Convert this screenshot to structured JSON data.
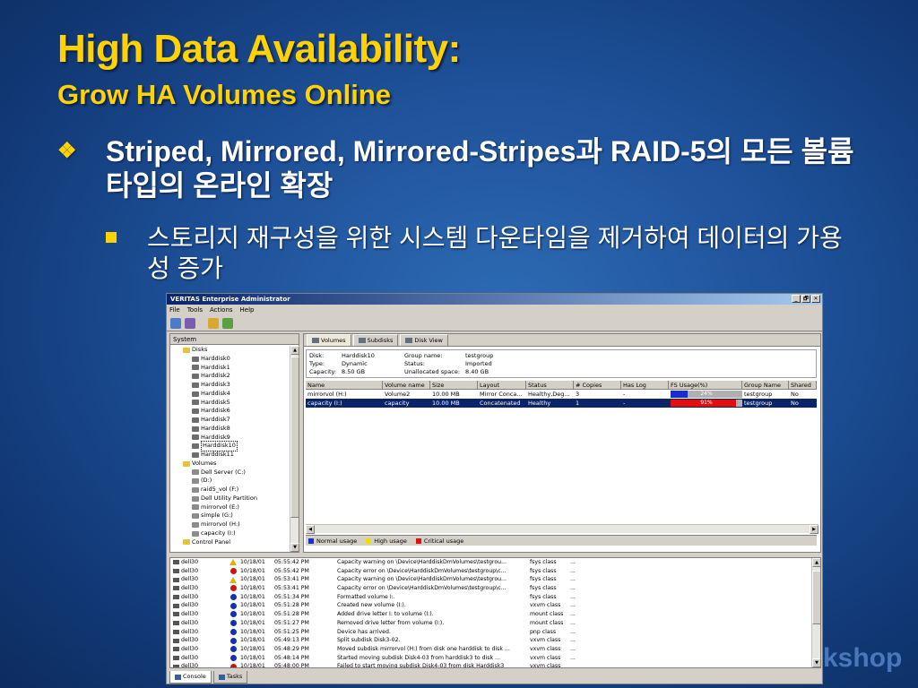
{
  "slide": {
    "title": "High Data Availability:",
    "subtitle": "Grow HA Volumes Online",
    "bullet1": "Striped, Mirrored,  Mirrored-Stripes과 RAID-5의 모든 볼륨 타입의 온라인 확장",
    "bullet2": "스토리지 재구성을 위한 시스템 다운타임을 제거하여 데이터의 가용성 증가",
    "bullet1_marker": "❖",
    "watermark": "kshop"
  },
  "window": {
    "title": "VERITAS Enterprise Administrator",
    "controls": [
      "_",
      "🗗",
      "✕"
    ],
    "menu": [
      "File",
      "Tools",
      "Actions",
      "Help"
    ],
    "toolbar_icons": [
      "connect-icon",
      "disconnect-icon",
      "new-window-icon",
      "new-volume-icon"
    ]
  },
  "tree": {
    "tab_label": "System",
    "items": [
      {
        "label": "Disks",
        "indent": 1,
        "icon": "fold"
      },
      {
        "label": "Harddisk0",
        "indent": 2,
        "icon": "disk"
      },
      {
        "label": "Harddisk1",
        "indent": 2,
        "icon": "disk"
      },
      {
        "label": "Harddisk2",
        "indent": 2,
        "icon": "disk"
      },
      {
        "label": "Harddisk3",
        "indent": 2,
        "icon": "disk"
      },
      {
        "label": "Harddisk4",
        "indent": 2,
        "icon": "disk"
      },
      {
        "label": "Harddisk5",
        "indent": 2,
        "icon": "disk"
      },
      {
        "label": "Harddisk6",
        "indent": 2,
        "icon": "disk"
      },
      {
        "label": "Harddisk7",
        "indent": 2,
        "icon": "disk"
      },
      {
        "label": "Harddisk8",
        "indent": 2,
        "icon": "disk"
      },
      {
        "label": "Harddisk9",
        "indent": 2,
        "icon": "disk"
      },
      {
        "label": "Harddisk10",
        "indent": 2,
        "icon": "disk",
        "selected": true
      },
      {
        "label": "Harddisk11",
        "indent": 2,
        "icon": "disk"
      },
      {
        "label": "Volumes",
        "indent": 1,
        "icon": "fold"
      },
      {
        "label": "Dell Server (C:)",
        "indent": 2,
        "icon": "vol"
      },
      {
        "label": "(D:)",
        "indent": 2,
        "icon": "vol"
      },
      {
        "label": "raid5_vol (F:)",
        "indent": 2,
        "icon": "vol"
      },
      {
        "label": "Dell Utility Partition",
        "indent": 2,
        "icon": "vol"
      },
      {
        "label": "mirrorvol (E:)",
        "indent": 2,
        "icon": "vol"
      },
      {
        "label": "simple (G:)",
        "indent": 2,
        "icon": "vol"
      },
      {
        "label": "mirrorvol (H:)",
        "indent": 2,
        "icon": "vol"
      },
      {
        "label": "capacity (I:)",
        "indent": 2,
        "icon": "vol"
      },
      {
        "label": "Control Panel",
        "indent": 1,
        "icon": "fold"
      }
    ]
  },
  "details": {
    "tabs": [
      "Volumes",
      "Subdisks",
      "Disk View"
    ],
    "info": [
      {
        "k1": "Disk:",
        "v1": "Harddisk10",
        "k2": "Group name:",
        "v2": "testgroup"
      },
      {
        "k1": "Type:",
        "v1": "Dynamic",
        "k2": "Status:",
        "v2": "Imported"
      },
      {
        "k1": "Capacity:",
        "v1": "8.50 GB",
        "k2": "Unallocated space:",
        "v2": "8.40 GB"
      }
    ],
    "columns": [
      "Name",
      "Volume name",
      "Size",
      "Layout",
      "Status",
      "# Copies",
      "Has Log",
      "FS Usage(%)",
      "Group Name",
      "Shared"
    ],
    "rows": [
      {
        "name": "mirrorvol (H:)",
        "volume_name": "Volume2",
        "size": "10.00 MB",
        "layout": "Mirror Conca...",
        "status": "Healthy,Deg...",
        "copies": "3",
        "has_log": "-",
        "fs_usage": 24,
        "fs_usage_label": "24%",
        "group": "testgroup",
        "shared": "No",
        "selected": false
      },
      {
        "name": "capacity (I:)",
        "volume_name": "capacity",
        "size": "10.00 MB",
        "layout": "Concatenated",
        "status": "Healthy",
        "copies": "1",
        "has_log": "-",
        "fs_usage": 91,
        "fs_usage_label": "91%",
        "group": "testgroup",
        "shared": "No",
        "selected": true
      }
    ],
    "legend": [
      {
        "label": "Normal usage",
        "color": "#1a2ed0"
      },
      {
        "label": "High usage",
        "color": "#f0e000"
      },
      {
        "label": "Critical usage",
        "color": "#e01010"
      }
    ]
  },
  "log": {
    "rows": [
      {
        "host": "dell30",
        "severity": "warning",
        "date": "10/18/01",
        "time": "05:55:42 PM",
        "message": "Capacity warning on \\Device\\HarddiskDmVolumes\\testgrou...",
        "source": "fsys class",
        "extra": "..."
      },
      {
        "host": "dell30",
        "severity": "error",
        "date": "10/18/01",
        "time": "05:55:42 PM",
        "message": "Capacity error on \\Device\\HarddiskDmVolumes\\testgroup\\c...",
        "source": "fsys class",
        "extra": "..."
      },
      {
        "host": "dell30",
        "severity": "warning",
        "date": "10/18/01",
        "time": "05:53:41 PM",
        "message": "Capacity warning on \\Device\\HarddiskDmVolumes\\testgrou...",
        "source": "fsys class",
        "extra": "..."
      },
      {
        "host": "dell30",
        "severity": "error",
        "date": "10/18/01",
        "time": "05:53:41 PM",
        "message": "Capacity error on \\Device\\HarddiskDmVolumes\\testgroup\\c...",
        "source": "fsys class",
        "extra": "..."
      },
      {
        "host": "dell30",
        "severity": "info",
        "date": "10/18/01",
        "time": "05:51:34 PM",
        "message": "Formatted volume I:.",
        "source": "fsys class",
        "extra": "..."
      },
      {
        "host": "dell30",
        "severity": "info",
        "date": "10/18/01",
        "time": "05:51:28 PM",
        "message": "Created new volume (I:).",
        "source": "vxvm class",
        "extra": "..."
      },
      {
        "host": "dell30",
        "severity": "info",
        "date": "10/18/01",
        "time": "05:51:28 PM",
        "message": "Added drive letter I: to volume (I:).",
        "source": "mount class",
        "extra": "..."
      },
      {
        "host": "dell30",
        "severity": "info",
        "date": "10/18/01",
        "time": "05:51:27 PM",
        "message": "Removed drive letter from volume (I:).",
        "source": "mount class",
        "extra": "..."
      },
      {
        "host": "dell30",
        "severity": "info",
        "date": "10/18/01",
        "time": "05:51:25 PM",
        "message": "Device  has arrived.",
        "source": "pnp class",
        "extra": "..."
      },
      {
        "host": "dell30",
        "severity": "info",
        "date": "10/18/01",
        "time": "05:49:13 PM",
        "message": "Split subdisk Disk3-02.",
        "source": "vxvm class",
        "extra": "..."
      },
      {
        "host": "dell30",
        "severity": "info",
        "date": "10/18/01",
        "time": "05:48:29 PM",
        "message": "Moved subdisk mirrorvol (H:) from disk one harddisk to disk ...",
        "source": "vxvm class",
        "extra": "..."
      },
      {
        "host": "dell30",
        "severity": "info",
        "date": "10/18/01",
        "time": "05:48:14 PM",
        "message": "Started moving subdisk Disk4-03 from harddisk3 to disk ...",
        "source": "vxvm class",
        "extra": "..."
      },
      {
        "host": "dell30",
        "severity": "error",
        "date": "10/18/01",
        "time": "05:48:00 PM",
        "message": "Failed to start moving subdisk Disk4-03 from disk Harddisk3",
        "source": "vxvm class",
        "extra": ""
      }
    ]
  },
  "bottom_tabs": [
    "Console",
    "Tasks"
  ]
}
